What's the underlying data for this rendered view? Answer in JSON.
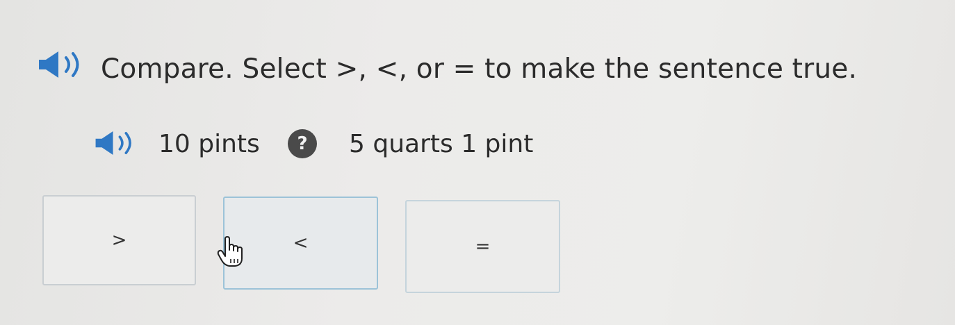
{
  "question": {
    "text": "Compare. Select >, <, or = to make the sentence true."
  },
  "comparison": {
    "left_quantity": "10 pints",
    "blank_symbol": "?",
    "right_quantity": "5 quarts 1 pint"
  },
  "choices": [
    {
      "label": ">"
    },
    {
      "label": "<"
    },
    {
      "label": "="
    }
  ],
  "icons": {
    "speaker": "speaker-icon",
    "blank": "question-mark-icon",
    "cursor": "hand-pointer-icon"
  },
  "colors": {
    "speaker_blue": "#2f78c4",
    "blank_fill": "#4a4a4a",
    "hover_border": "#9cc3d8"
  }
}
